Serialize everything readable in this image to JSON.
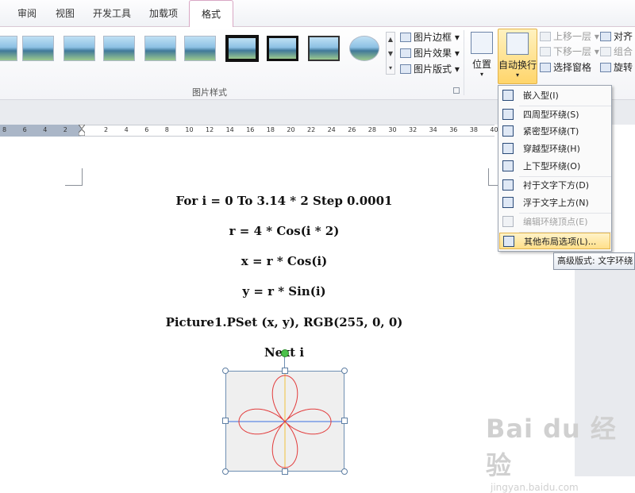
{
  "tabs": [
    {
      "label": "审阅",
      "active": false
    },
    {
      "label": "视图",
      "active": false
    },
    {
      "label": "开发工具",
      "active": false
    },
    {
      "label": "加载项",
      "active": false
    },
    {
      "label": "格式",
      "active": true
    }
  ],
  "ribbon": {
    "picture_styles_group": {
      "label": "图片样式",
      "border_btn": "图片边框",
      "effects_btn": "图片效果",
      "layout_btn": "图片版式"
    },
    "arrange_group": {
      "position_btn": "位置",
      "wrap_btn": "自动换行",
      "bring_forward": "上移一层",
      "send_backward": "下移一层",
      "selection_pane": "选择窗格",
      "align": "对齐",
      "group": "组合",
      "rotate": "旋转"
    }
  },
  "ruler": {
    "numbers": [
      "8",
      "6",
      "4",
      "2",
      "",
      "2",
      "4",
      "6",
      "8",
      "10",
      "12",
      "14",
      "16",
      "18",
      "20",
      "22",
      "24",
      "26",
      "28",
      "30",
      "32",
      "34",
      "36",
      "38",
      "40"
    ]
  },
  "document": {
    "lines": [
      "For i = 0 To 3.14 * 2 Step 0.0001",
      "r = 4 * Cos(i * 2)",
      "x = r * Cos(i)",
      "y = r * Sin(i)",
      "Picture1.PSet (x, y), RGB(255, 0, 0)",
      "Next i"
    ]
  },
  "wrap_menu": {
    "items": [
      {
        "label": "嵌入型(I)",
        "disabled": false,
        "selected": false
      },
      {
        "label": "四周型环绕(S)",
        "disabled": false,
        "selected": false
      },
      {
        "label": "紧密型环绕(T)",
        "disabled": false,
        "selected": false
      },
      {
        "label": "穿越型环绕(H)",
        "disabled": false,
        "selected": false
      },
      {
        "label": "上下型环绕(O)",
        "disabled": false,
        "selected": false
      },
      {
        "label": "衬于文字下方(D)",
        "disabled": false,
        "selected": false
      },
      {
        "label": "浮于文字上方(N)",
        "disabled": false,
        "selected": false
      },
      {
        "label": "编辑环绕顶点(E)",
        "disabled": true,
        "selected": false
      },
      {
        "label": "其他布局选项(L)...",
        "disabled": false,
        "selected": true
      }
    ]
  },
  "tooltip": "高级版式: 文字环绕",
  "watermark": {
    "main": "Bai du 经验",
    "sub": "jingyan.baidu.com"
  },
  "colors": {
    "active_tab_border": "#d9a7c4",
    "highlight": "#ffd56b",
    "curve": "#e23b3b",
    "axis_x": "#3b6fe2",
    "axis_y": "#f0c23c"
  }
}
